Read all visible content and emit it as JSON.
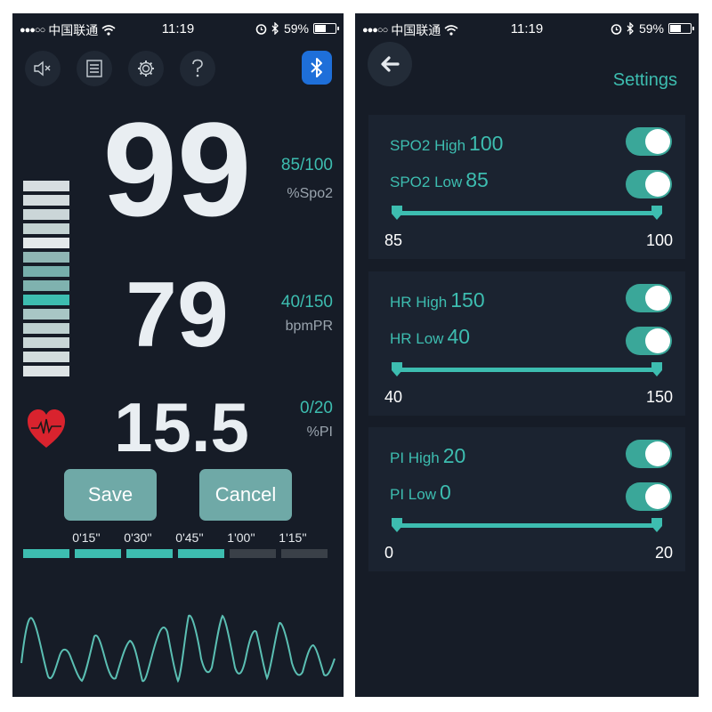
{
  "status_bar": {
    "signal": "●●●○○",
    "carrier": "中国联通",
    "time": "11:19",
    "battery": "59%",
    "battery_level": 0.59
  },
  "monitor": {
    "toolbar": [
      "mute-icon",
      "list-icon",
      "gear-icon",
      "help-icon",
      "bluetooth-icon"
    ],
    "spo2": {
      "value": "99",
      "range": "85/100",
      "unit": "%Spo2"
    },
    "pr": {
      "value": "79",
      "range": "40/150",
      "unit": "bpmPR"
    },
    "pi": {
      "value": "15.5",
      "range": "0/20",
      "unit": "%PI"
    },
    "save_label": "Save",
    "cancel_label": "Cancel",
    "timeline": {
      "labels": [
        "0'15''",
        "0'30''",
        "0'45''",
        "1'00''",
        "1'15''"
      ],
      "filled_segments": 4,
      "total_segments": 6
    },
    "colors": {
      "accent": "#3dbdb0",
      "background": "#161c27",
      "heart": "#d9232e",
      "button": "#6fa9a7"
    }
  },
  "settings": {
    "title": "Settings",
    "groups": [
      {
        "high_label": "SPO2 High",
        "high_value": "100",
        "low_label": "SPO2 Low",
        "low_value": "85",
        "min": "85",
        "max": "100",
        "high_on": true,
        "low_on": true
      },
      {
        "high_label": "HR High",
        "high_value": "150",
        "low_label": "HR Low",
        "low_value": "40",
        "min": "40",
        "max": "150",
        "high_on": true,
        "low_on": true
      },
      {
        "high_label": "PI High",
        "high_value": "20",
        "low_label": "PI Low",
        "low_value": "0",
        "min": "0",
        "max": "20",
        "high_on": true,
        "low_on": true
      }
    ]
  }
}
